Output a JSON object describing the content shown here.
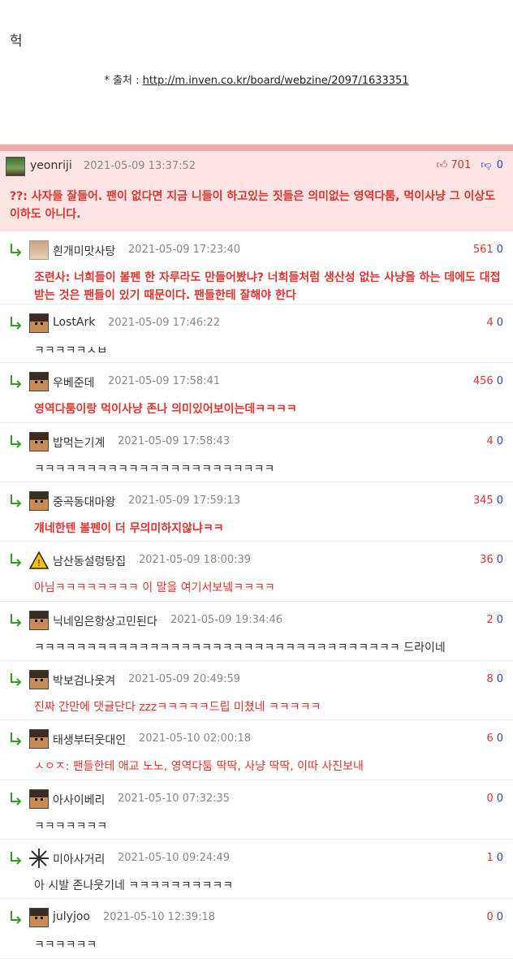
{
  "post": {
    "text": "헉",
    "source_prefix": "* 출처 : ",
    "source_link": "http://m.inven.co.kr/board/webzine/2097/1633351"
  },
  "best_comment": {
    "nick": "yeonriji",
    "date": "2021-05-09 13:37:52",
    "up": "701",
    "down": "0",
    "text": "??: 사자들 잘들어. 팬이 없다면 지금 니들이 하고있는 짓들은 의미없는 영역다툼, 먹이사냥 그 이상도 이하도 아니다.",
    "colors": {
      "accent": "#e0342f",
      "band": "#f4a7a7",
      "bg": "#ffe4e4"
    }
  },
  "replies": [
    {
      "nick": "흰개미맛사탕",
      "date": "2021-05-09 17:23:40",
      "up": "561",
      "down": "0",
      "text": "조련사: 너희들이 볼펜 한 자루라도 만들어봤냐? 너희들처럼 생산성 없는 사냥을 하는 데에도 대접받는 것은 팬들이 있기 때문이다. 팬들한테 잘해야 한다",
      "style": "red-bold",
      "avatar": "face-icon"
    },
    {
      "nick": "LostArk",
      "date": "2021-05-09 17:46:22",
      "up": "4",
      "down": "0",
      "text": "ㅋㅋㅋㅋㅋㅅㅂ",
      "style": "plain",
      "avatar": "pixel-avatar-icon"
    },
    {
      "nick": "우베준데",
      "date": "2021-05-09 17:58:41",
      "up": "456",
      "down": "0",
      "text": "영역다툼이랑 먹이사냥 존나 의미있어보이는데ㅋㅋㅋㅋ",
      "style": "red-bold",
      "avatar": "pixel-avatar-icon"
    },
    {
      "nick": "밥먹는기계",
      "date": "2021-05-09 17:58:43",
      "up": "4",
      "down": "0",
      "text": "ㅋㅋㅋㅋㅋㅋㅋㅋㅋㅋㅋㅋㅋㅋㅋㅋㅋㅋㅋㅋㅋㅋㅋ",
      "style": "plain",
      "avatar": "pixel-avatar-icon"
    },
    {
      "nick": "중곡동대마왕",
      "date": "2021-05-09 17:59:13",
      "up": "345",
      "down": "0",
      "text": "걔네한텐 볼펜이 더 무의미하지않냐ㅋㅋ",
      "style": "red-bold",
      "avatar": "pixel-avatar-icon"
    },
    {
      "nick": "남산동설렁탕집",
      "date": "2021-05-09 18:00:39",
      "up": "36",
      "down": "0",
      "text": "아님ㅋㅋㅋㅋㅋㅋㅋㅋ 이 말을 여기서보넼ㅋㅋㅋㅋ",
      "style": "red",
      "avatar": "warning-sign-icon"
    },
    {
      "nick": "닉네임은항상고민된다",
      "date": "2021-05-09 19:34:46",
      "up": "2",
      "down": "0",
      "text": "ㅋㅋㅋㅋㅋㅋㅋㅋㅋㅋㅋㅋㅋㅋㅋㅋㅋㅋㅋㅋㅋㅋㅋㅋㅋㅋㅋㅋㅋㅋㅋㅋㅋㅋㅋ 드라이네",
      "style": "plain",
      "avatar": "pixel-avatar-icon"
    },
    {
      "nick": "박보검나웃겨",
      "date": "2021-05-09 20:49:59",
      "up": "8",
      "down": "0",
      "text": "진짜 간만에 댓글단다 zzzㅋㅋㅋㅋㅋ드립 미쳤네 ㅋㅋㅋㅋㅋ",
      "style": "red",
      "avatar": "pixel-avatar-icon"
    },
    {
      "nick": "태생부터웃대인",
      "date": "2021-05-10 02:00:18",
      "up": "6",
      "down": "0",
      "text": "ㅅㅇㅈ: 팬들한테 애교 노노, 영역다툼 딱딱, 사냥 딱딱, 이따 사진보내",
      "style": "red",
      "avatar": "pixel-avatar-icon"
    },
    {
      "nick": "아사이베리",
      "date": "2021-05-10 07:32:35",
      "up": "0",
      "down": "0",
      "text": "ㅋㅋㅋㅋㅋㅋㅋ",
      "style": "plain",
      "avatar": "pixel-avatar-icon"
    },
    {
      "nick": "미아사거리",
      "date": "2021-05-10 09:24:49",
      "up": "1",
      "down": "0",
      "text": "아 시발 존나웃기네 ㅋㅋㅋㅋㅋㅋㅋㅋㅋㅋ",
      "style": "plain",
      "avatar": "pattern-avatar-icon"
    },
    {
      "nick": "julyjoo",
      "date": "2021-05-10 12:39:18",
      "up": "0",
      "down": "0",
      "text": "ㅋㅋㅋㅋㅋㅋ",
      "style": "plain",
      "avatar": "pixel-avatar-icon"
    }
  ]
}
